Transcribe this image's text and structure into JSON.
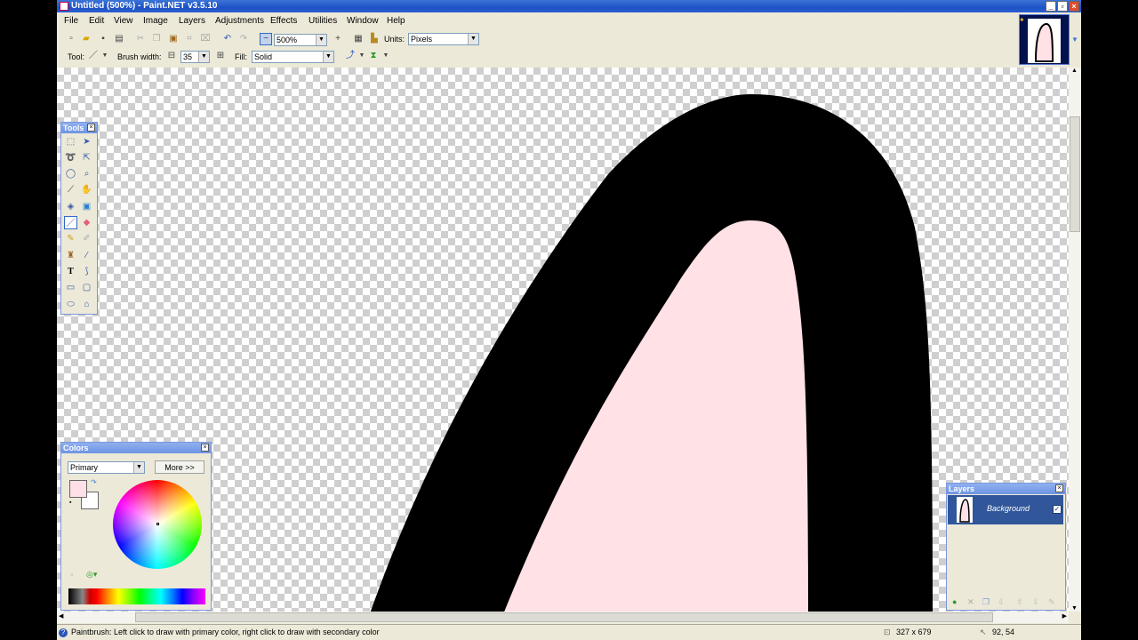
{
  "window": {
    "title": "Untitled (500%) - Paint.NET v3.5.10"
  },
  "menu": [
    "File",
    "Edit",
    "View",
    "Image",
    "Layers",
    "Adjustments",
    "Effects",
    "Utilities",
    "Window",
    "Help"
  ],
  "toolbar": {
    "zoom_value": "500%",
    "units_label": "Units:",
    "units_value": "Pixels",
    "tool_label": "Tool:",
    "brush_width_label": "Brush width:",
    "brush_width_value": "35",
    "fill_label": "Fill:",
    "fill_value": "Solid"
  },
  "tools_panel": {
    "title": "Tools",
    "selected": "paintbrush"
  },
  "colors_panel": {
    "title": "Colors",
    "mode_value": "Primary",
    "more_button": "More >>",
    "primary_color": "#ffe0e6",
    "secondary_color": "#ffffff"
  },
  "layers_panel": {
    "title": "Layers",
    "layers": [
      {
        "name": "Background",
        "visible": true
      }
    ]
  },
  "canvas": {
    "shape_fill": "#ffe1e6",
    "shape_outline": "#000000"
  },
  "status": {
    "hint": "Paintbrush: Left click to draw with primary color, right click to draw with secondary color",
    "image_size": "327 x 679",
    "cursor_pos": "92, 54"
  },
  "icons": [
    "app-icon",
    "new-icon",
    "open-icon",
    "save-icon",
    "print-icon",
    "cut-icon",
    "copy-icon",
    "paste-icon",
    "undo-icon",
    "redo-icon",
    "zoom-out-icon",
    "zoom-in-icon",
    "grid-icon",
    "ruler-icon",
    "help-icon",
    "paintbrush-icon"
  ]
}
